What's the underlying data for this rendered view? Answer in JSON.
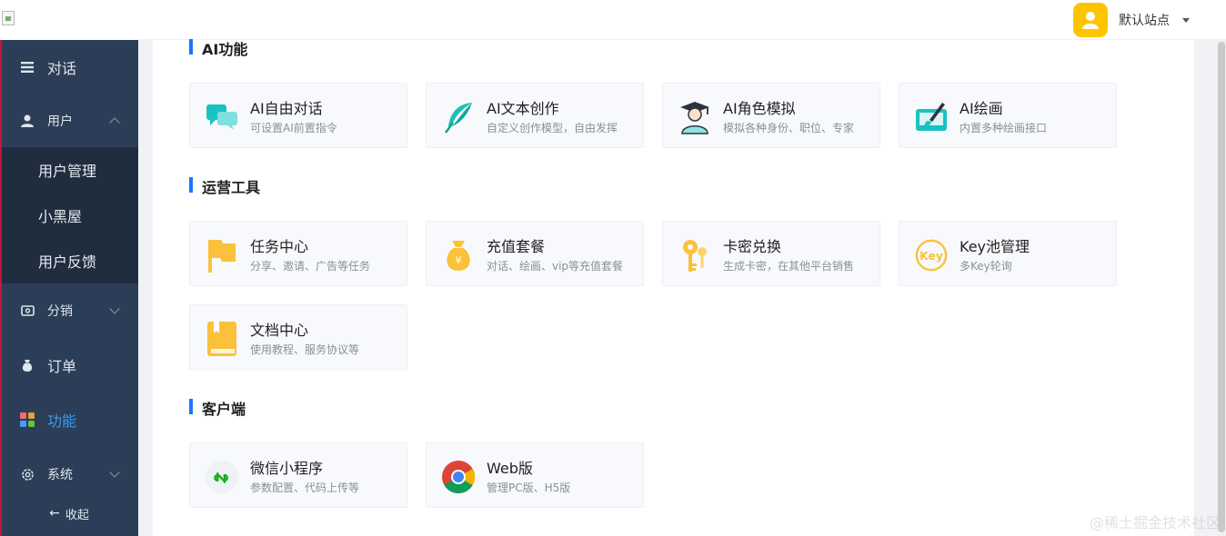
{
  "sidebar": {
    "items": [
      {
        "label": "对话",
        "icon": "menu-icon"
      },
      {
        "label": "用户",
        "icon": "user-icon",
        "expanded": true,
        "children": [
          {
            "label": "用户管理"
          },
          {
            "label": "小黑屋"
          },
          {
            "label": "用户反馈"
          }
        ]
      },
      {
        "label": "分销",
        "icon": "distribution-icon"
      },
      {
        "label": "订单",
        "icon": "money-bag-icon"
      },
      {
        "label": "功能",
        "icon": "apps-icon",
        "active": true
      },
      {
        "label": "系统",
        "icon": "gear-icon"
      }
    ],
    "collapse_label": "收起"
  },
  "header": {
    "site_name": "默认站点"
  },
  "sections": [
    {
      "title": "AI功能",
      "cards": [
        {
          "title": "AI自由对话",
          "desc": "可设置AI前置指令",
          "icon": "chat-bubbles-icon"
        },
        {
          "title": "AI文本创作",
          "desc": "自定义创作模型，自由发挥",
          "icon": "feather-icon"
        },
        {
          "title": "AI角色模拟",
          "desc": "模拟各种身份、职位、专家",
          "icon": "graduate-icon"
        },
        {
          "title": "AI绘画",
          "desc": "内置多种绘画接口",
          "icon": "paint-brush-icon"
        }
      ]
    },
    {
      "title": "运营工具",
      "cards": [
        {
          "title": "任务中心",
          "desc": "分享、邀请、广告等任务",
          "icon": "flag-icon"
        },
        {
          "title": "充值套餐",
          "desc": "对话、绘画、vip等充值套餐",
          "icon": "money-bag-icon"
        },
        {
          "title": "卡密兑换",
          "desc": "生成卡密，在其他平台销售",
          "icon": "keys-icon"
        },
        {
          "title": "Key池管理",
          "desc": "多Key轮询",
          "icon": "key-badge-icon"
        },
        {
          "title": "文档中心",
          "desc": "使用教程、服务协议等",
          "icon": "book-icon"
        }
      ]
    },
    {
      "title": "客户端",
      "cards": [
        {
          "title": "微信小程序",
          "desc": "参数配置、代码上传等",
          "icon": "mini-program-icon"
        },
        {
          "title": "Web版",
          "desc": "管理PC版、H5版",
          "icon": "chrome-icon"
        }
      ]
    }
  ],
  "watermark": "@稀土掘金技术社区",
  "colors": {
    "sidebar_bg": "#2c3e57",
    "submenu_bg": "#1f2d3f",
    "accent": "#1677ff",
    "active_text": "#3a9bf5",
    "avatar_bg": "#ffc400"
  }
}
